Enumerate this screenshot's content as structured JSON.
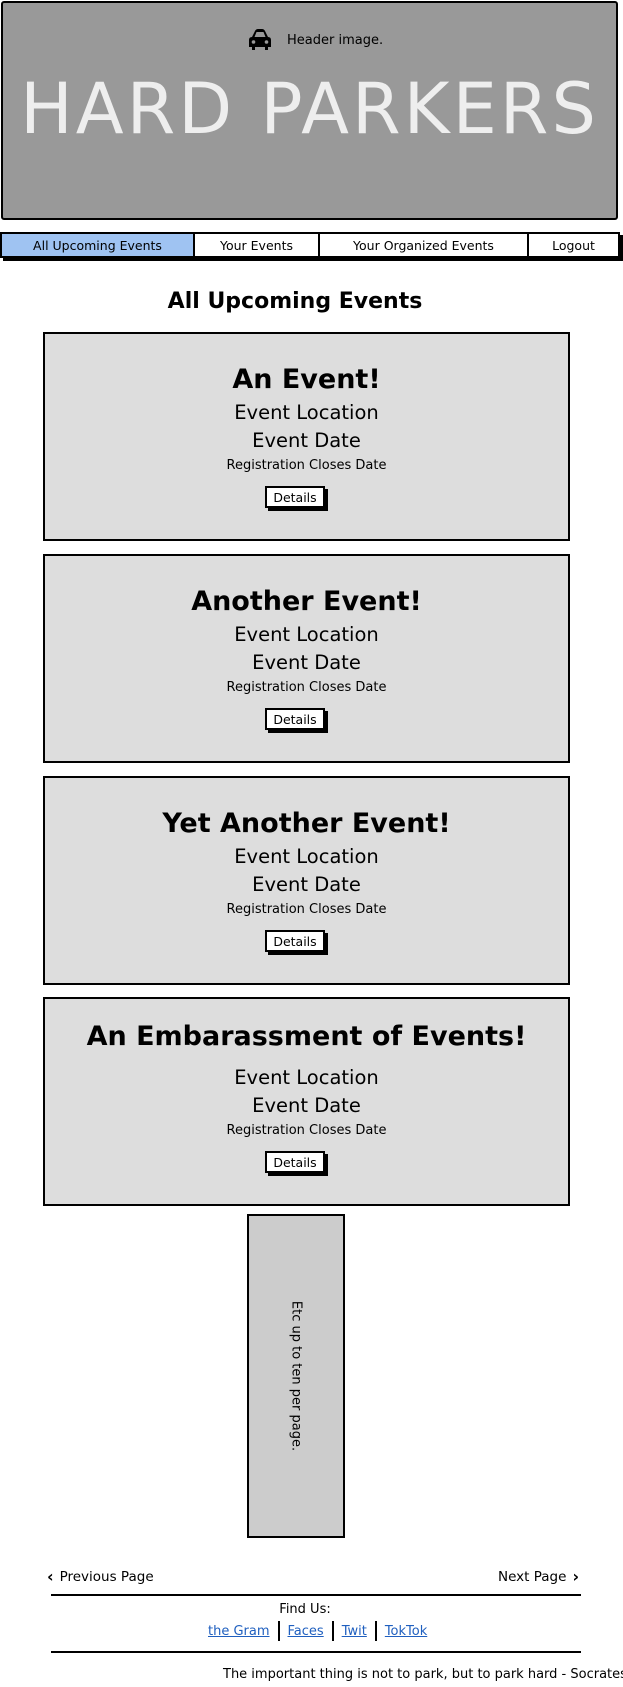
{
  "header": {
    "caption": "Header image.",
    "title": "HARD PARKERS",
    "icon": "car-icon"
  },
  "nav": {
    "items": [
      {
        "label": "All Upcoming Events",
        "active": true
      },
      {
        "label": "Your Events"
      },
      {
        "label": "Your Organized Events"
      },
      {
        "label": "Logout"
      }
    ]
  },
  "page": {
    "heading": "All Upcoming Events"
  },
  "events": [
    {
      "title": "An Event!",
      "location": "Event Location",
      "date": "Event Date",
      "registration": "Registration Closes Date",
      "button": "Details"
    },
    {
      "title": "Another Event!",
      "location": "Event Location",
      "date": "Event Date",
      "registration": "Registration Closes Date",
      "button": "Details"
    },
    {
      "title": "Yet Another Event!",
      "location": "Event Location",
      "date": "Event Date",
      "registration": "Registration Closes Date",
      "button": "Details"
    },
    {
      "title": "An Embarassment of Events!",
      "location": "Event Location",
      "date": "Event Date",
      "registration": "Registration Closes Date",
      "button": "Details"
    }
  ],
  "etc_note": "Etc up to ten per page.",
  "pagination": {
    "prev": "Previous Page",
    "next": "Next Page"
  },
  "footer": {
    "find_us": "Find Us:",
    "links": [
      "the Gram",
      "Faces",
      "Twit",
      "TokTok"
    ],
    "quote": "The important thing is not to park, but to park hard - Socrates"
  },
  "colors": {
    "header_bg": "#999999",
    "nav_active": "#9fc3f2",
    "card_bg": "#dddddd",
    "link": "#1f5fbf"
  }
}
